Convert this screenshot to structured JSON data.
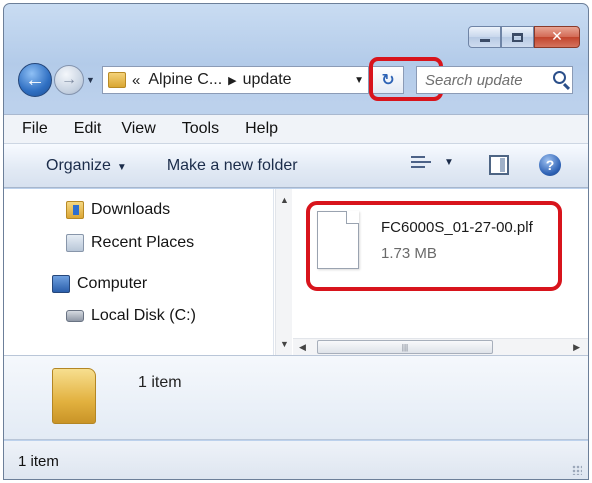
{
  "address": {
    "chevron": "«",
    "crumb": "Alpine C...",
    "current": "update"
  },
  "search": {
    "placeholder": "Search update"
  },
  "menu": [
    "File",
    "Edit",
    "View",
    "Tools",
    "Help"
  ],
  "toolbar": {
    "organize": "Organize",
    "new_folder": "Make a new folder"
  },
  "nav": {
    "items": [
      "Downloads",
      "Recent Places",
      "Computer",
      "Local Disk (C:)"
    ]
  },
  "file": {
    "name": "FC6000S_01-27-00.plf",
    "size": "1.73 MB"
  },
  "details": {
    "count": "1 item"
  },
  "status": {
    "text": "1 item"
  },
  "colors": {
    "highlight": "#d8141c"
  }
}
